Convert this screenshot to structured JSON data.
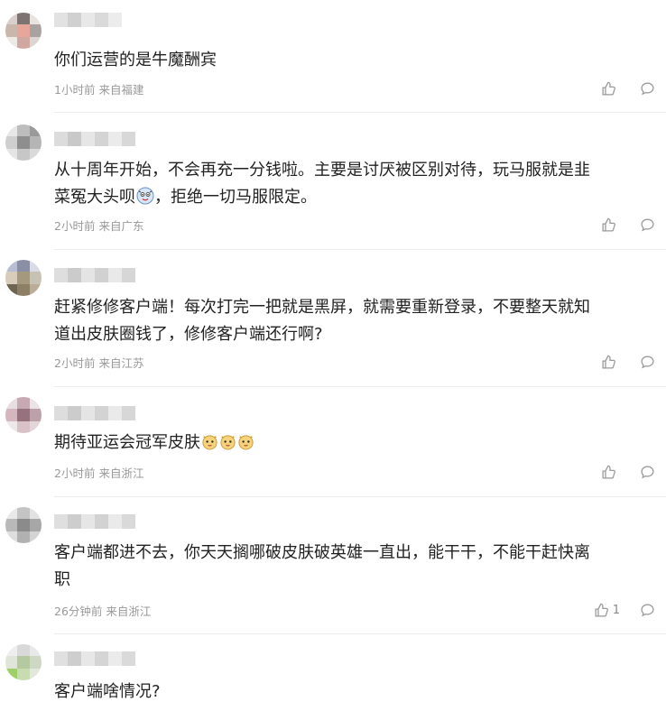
{
  "comments": [
    {
      "text": "你们运营的是牛魔酬宾",
      "time": "1小时前",
      "location": "来自福建",
      "likes": ""
    },
    {
      "text_line1": "从十周年开始，不会再充一分钱啦。主要是讨厌被区别对待，玩马服就是韭",
      "text_line2_a": "菜冤大头呗",
      "text_line2_b": "，拒绝一切马服限定。",
      "emoji": "doge-face-emoji",
      "time": "2小时前",
      "location": "来自广东",
      "likes": ""
    },
    {
      "text_line1": "赶紧修修客户端！每次打完一把就是黑屏，就需要重新登录，不要整天就知",
      "text_line2": "道出皮肤圈钱了，修修客户端还行啊?",
      "time": "2小时前",
      "location": "来自江苏",
      "likes": ""
    },
    {
      "text": "期待亚运会冠军皮肤",
      "emoji": "cat-face-emoji",
      "time": "2小时前",
      "location": "来自浙江",
      "likes": ""
    },
    {
      "text_line1": "客户端都进不去，你天天搁哪破皮肤破英雄一直出，能干干，不能干赶快离",
      "text_line2": "职",
      "time": "26分钟前",
      "location": "来自浙江",
      "likes": "1"
    },
    {
      "text": "客户端啥情况?",
      "time": "",
      "location": "",
      "likes": ""
    }
  ],
  "colors": {
    "text": "#222222",
    "meta": "#999999",
    "divider": "#ececec",
    "icon": "#999999"
  },
  "icons": [
    "thumbs-up-icon",
    "comment-bubble-icon"
  ]
}
